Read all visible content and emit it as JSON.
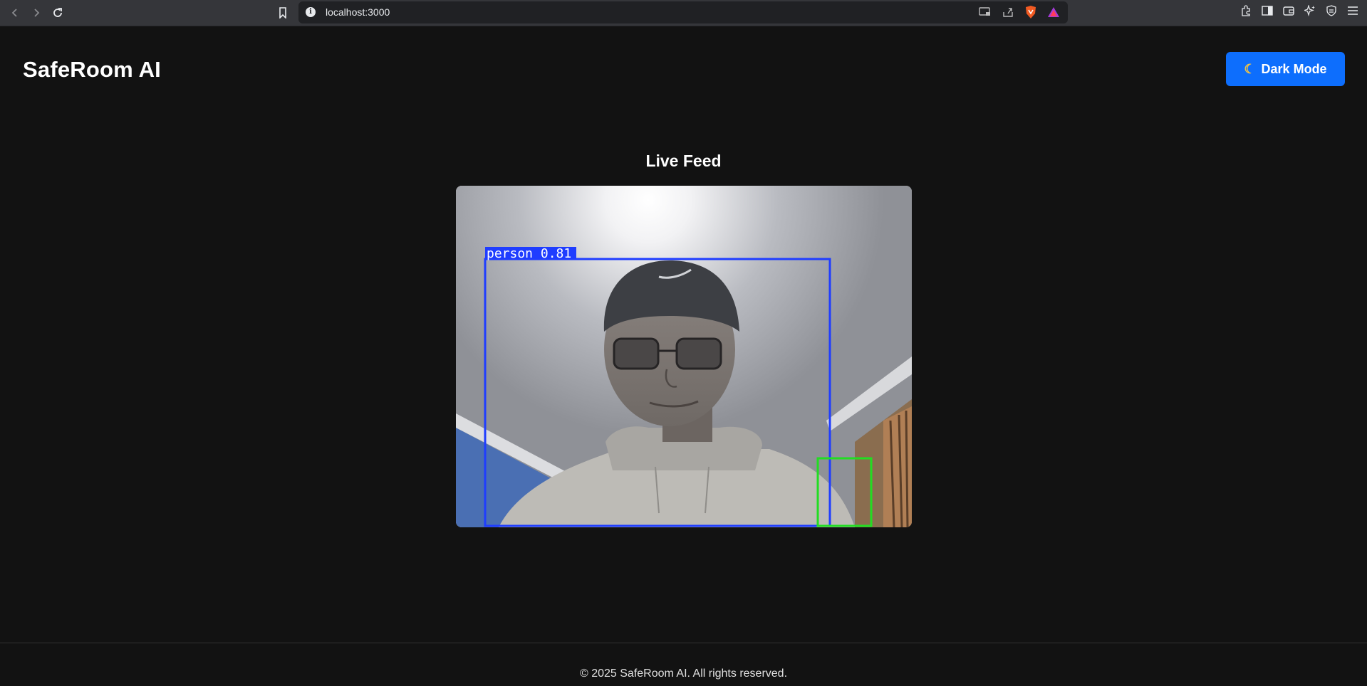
{
  "browser": {
    "url": "localhost:3000"
  },
  "header": {
    "title": "SafeRoom AI",
    "theme_button_label": "Dark Mode",
    "theme_button_icon": "moon-icon"
  },
  "main": {
    "feed_title": "Live Feed",
    "detections": [
      {
        "label": "person 0.81",
        "color": "#1f3dff"
      },
      {
        "label": "",
        "color": "#22dd22"
      }
    ]
  },
  "footer": {
    "text": "© 2025 SafeRoom AI. All rights reserved."
  },
  "colors": {
    "background": "#121212",
    "accent": "#0d6efd",
    "text": "#ffffff"
  }
}
